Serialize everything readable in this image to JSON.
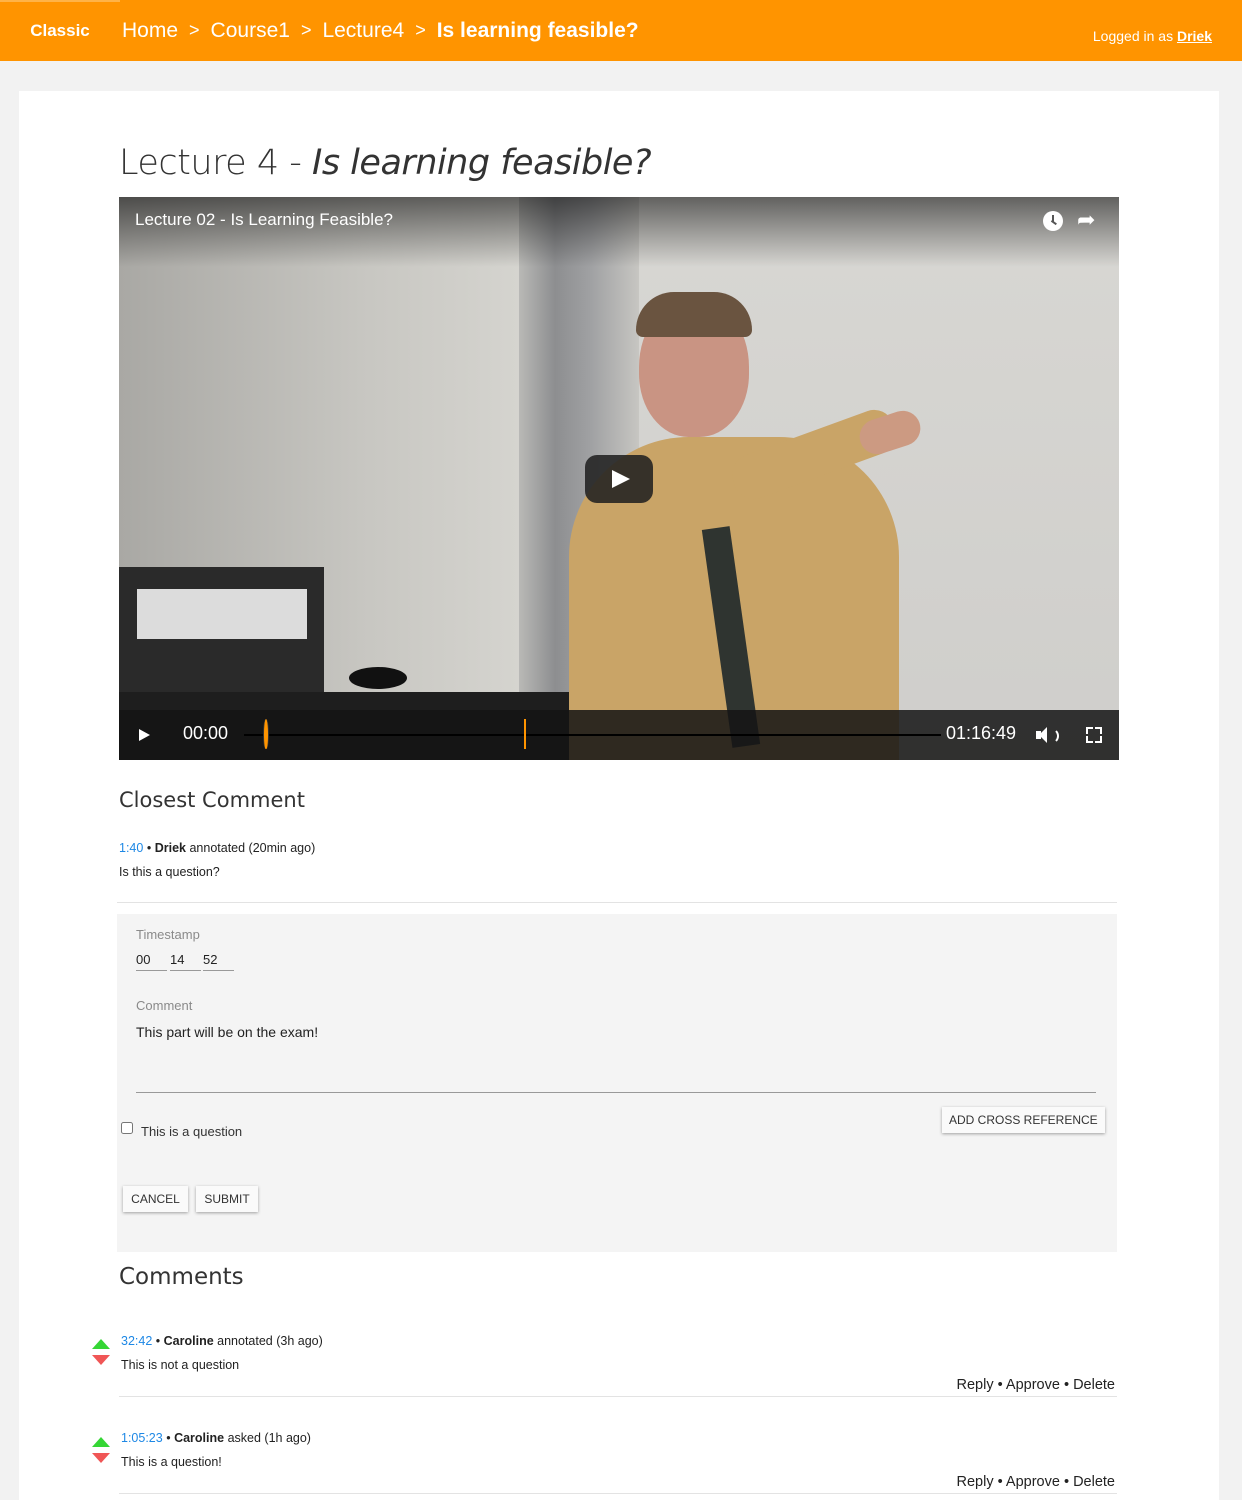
{
  "topbar": {
    "classic_label": "Classic",
    "breadcrumb": [
      "Home",
      "Course1",
      "Lecture4"
    ],
    "breadcrumb_sep": ">",
    "breadcrumb_current": "Is learning feasible?",
    "logged_prefix": "Logged in as",
    "user": "Driek"
  },
  "page": {
    "title_prefix": "Lecture 4 - ",
    "title_italic": "Is learning feasible?"
  },
  "video": {
    "title": "Lecture 02 - Is Learning Feasible?",
    "current_time": "00:00",
    "duration": "01:16:49",
    "icons": [
      "clock-icon",
      "share-icon",
      "play-icon",
      "volume-icon",
      "fullscreen-icon"
    ]
  },
  "closest": {
    "heading": "Closest Comment",
    "timestamp": "1:40",
    "bullet": "•",
    "author": "Driek",
    "action": "annotated (20min ago)",
    "text": "Is this a question?"
  },
  "form": {
    "timestamp_label": "Timestamp",
    "hours": "00",
    "minutes": "14",
    "seconds": "52",
    "comment_label": "Comment",
    "comment_value": "This part will be on the exam!",
    "checkbox_label": "This is a question",
    "cross_ref_label": "ADD CROSS REFERENCE",
    "cancel_label": "CANCEL",
    "submit_label": "SUBMIT"
  },
  "comments": {
    "heading": "Comments",
    "items": [
      {
        "timestamp": "32:42",
        "bullet": "•",
        "author": "Caroline",
        "action": "annotated (3h ago)",
        "text": "This is not a question",
        "reply": "Reply",
        "approve": "Approve",
        "delete": "Delete",
        "sep": "•"
      },
      {
        "timestamp": "1:05:23",
        "bullet": "•",
        "author": "Caroline",
        "action": "asked (1h ago)",
        "text": "This is a question!",
        "reply": "Reply",
        "approve": "Approve",
        "delete": "Delete",
        "sep": "•"
      }
    ]
  },
  "colors": {
    "accent": "#ff9400",
    "link": "#1e88e5",
    "upvote": "#35d635",
    "downvote": "#f05656"
  }
}
